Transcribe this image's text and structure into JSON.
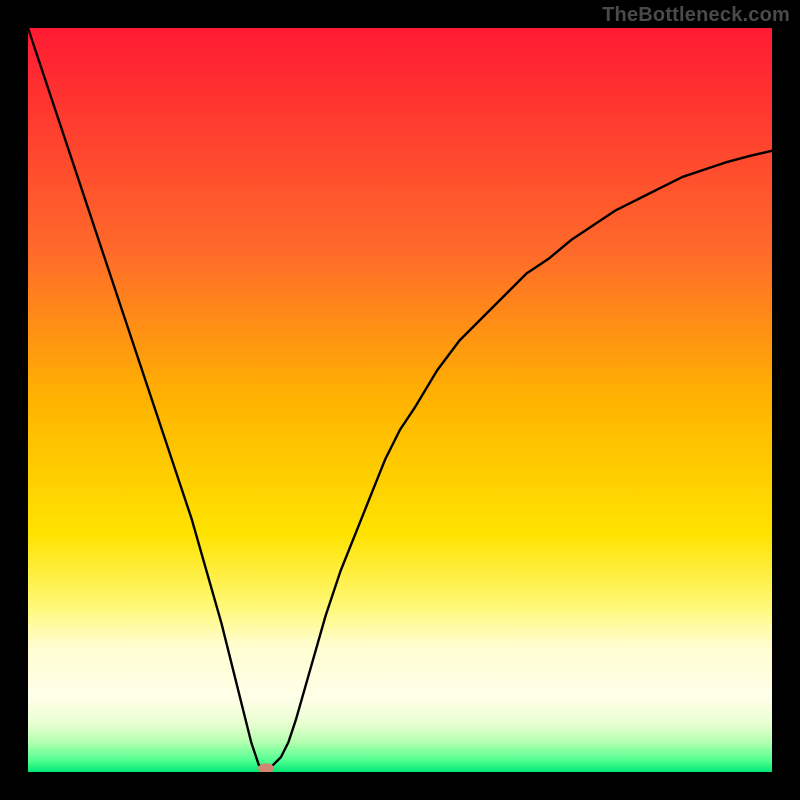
{
  "watermark": "TheBottleneck.com",
  "chart_data": {
    "type": "line",
    "title": "",
    "xlabel": "",
    "ylabel": "",
    "xlim": [
      0,
      100
    ],
    "ylim": [
      0,
      100
    ],
    "x": [
      0,
      2,
      4,
      6,
      8,
      10,
      12,
      14,
      16,
      18,
      20,
      22,
      24,
      26,
      27,
      28,
      29,
      30,
      31,
      32,
      33,
      34,
      35,
      36,
      38,
      40,
      42,
      44,
      46,
      48,
      50,
      52,
      55,
      58,
      61,
      64,
      67,
      70,
      73,
      76,
      79,
      82,
      85,
      88,
      91,
      94,
      97,
      100
    ],
    "values": [
      100,
      94,
      88,
      82,
      76,
      70,
      64,
      58,
      52,
      46,
      40,
      34,
      27,
      20,
      16,
      12,
      8,
      4,
      1,
      0,
      1,
      2,
      4,
      7,
      14,
      21,
      27,
      32,
      37,
      42,
      46,
      49,
      54,
      58,
      61,
      64,
      67,
      69,
      71.5,
      73.5,
      75.5,
      77,
      78.5,
      80,
      81,
      82,
      82.8,
      83.5
    ],
    "minimum_x": 32,
    "marker": {
      "x": 32,
      "y": 0.5,
      "color": "#d0876f"
    },
    "gradient_stops": [
      {
        "offset": 0.0,
        "color": "#ff1a33"
      },
      {
        "offset": 0.12,
        "color": "#ff3a2f"
      },
      {
        "offset": 0.3,
        "color": "#ff6a2a"
      },
      {
        "offset": 0.5,
        "color": "#ffb300"
      },
      {
        "offset": 0.68,
        "color": "#ffe300"
      },
      {
        "offset": 0.78,
        "color": "#fff97a"
      },
      {
        "offset": 0.83,
        "color": "#fffdd0"
      },
      {
        "offset": 0.9,
        "color": "#ffffe9"
      },
      {
        "offset": 0.935,
        "color": "#e8ffd0"
      },
      {
        "offset": 0.96,
        "color": "#b3ffb0"
      },
      {
        "offset": 0.985,
        "color": "#4fff8f"
      },
      {
        "offset": 1.0,
        "color": "#00e676"
      }
    ]
  }
}
